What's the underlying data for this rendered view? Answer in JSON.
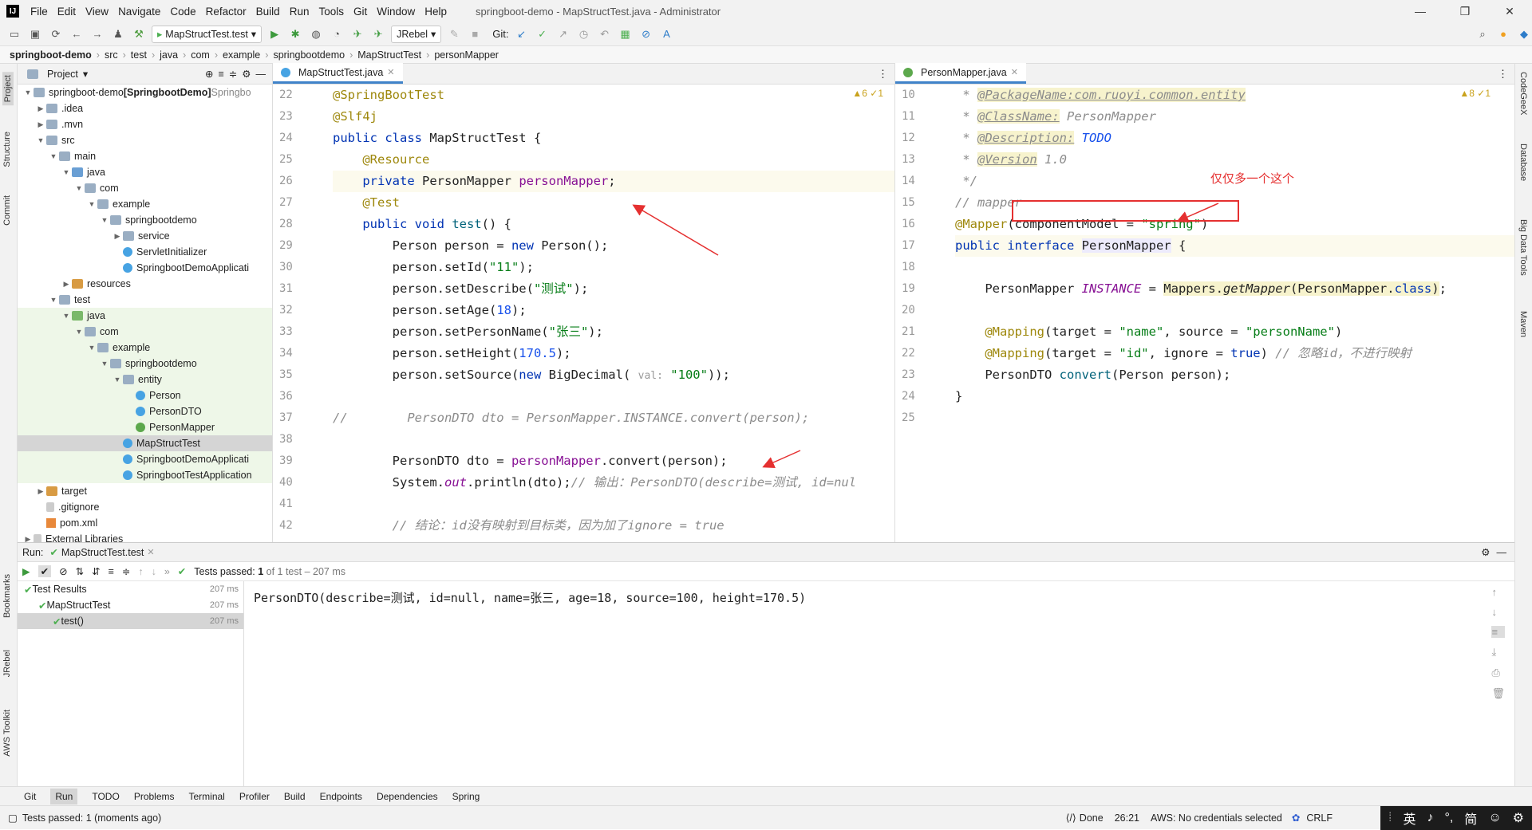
{
  "title_bar": {
    "app_icon": "IJ",
    "menu": [
      "File",
      "Edit",
      "View",
      "Navigate",
      "Code",
      "Refactor",
      "Build",
      "Run",
      "Tools",
      "Git",
      "Window",
      "Help"
    ],
    "title": "springboot-demo - MapStructTest.java - Administrator"
  },
  "toolbar": {
    "run_config": "MapStructTest.test",
    "jrebel": "JRebel",
    "git_label": "Git:"
  },
  "breadcrumb": [
    "springboot-demo",
    "src",
    "test",
    "java",
    "com",
    "example",
    "springbootdemo",
    "MapStructTest",
    "personMapper"
  ],
  "left_strip": [
    "Project",
    "Structure",
    "Commit",
    "Bookmarks",
    "JRebel",
    "AWS Toolkit"
  ],
  "right_strip": [
    "CodeGeeX",
    "Database",
    "Big Data Tools",
    "Maven"
  ],
  "project": {
    "header": "Project",
    "tree": [
      {
        "label": "springboot-demo",
        "extra": "[SpringbootDemo]",
        "hint": "Springbo",
        "depth": 0,
        "icon": "folder",
        "arrow": "v"
      },
      {
        "label": ".idea",
        "depth": 1,
        "icon": "folder",
        "arrow": ">"
      },
      {
        "label": ".mvn",
        "depth": 1,
        "icon": "folder",
        "arrow": ">"
      },
      {
        "label": "src",
        "depth": 1,
        "icon": "folder",
        "arrow": "v"
      },
      {
        "label": "main",
        "depth": 2,
        "icon": "folder",
        "arrow": "v"
      },
      {
        "label": "java",
        "depth": 3,
        "icon": "folderb",
        "arrow": "v"
      },
      {
        "label": "com",
        "depth": 4,
        "icon": "folder",
        "arrow": "v"
      },
      {
        "label": "example",
        "depth": 5,
        "icon": "folder",
        "arrow": "v"
      },
      {
        "label": "springbootdemo",
        "depth": 6,
        "icon": "folder",
        "arrow": "v"
      },
      {
        "label": "service",
        "depth": 7,
        "icon": "folder",
        "arrow": ">"
      },
      {
        "label": "ServletInitializer",
        "depth": 7,
        "icon": "cls",
        "arrow": ""
      },
      {
        "label": "SpringbootDemoApplicati",
        "depth": 7,
        "icon": "cls",
        "arrow": ""
      },
      {
        "label": "resources",
        "depth": 3,
        "icon": "foldero",
        "arrow": ">"
      },
      {
        "label": "test",
        "depth": 2,
        "icon": "folder",
        "arrow": "v"
      },
      {
        "label": "java",
        "depth": 3,
        "icon": "folderg",
        "arrow": "v",
        "green": true
      },
      {
        "label": "com",
        "depth": 4,
        "icon": "folder",
        "arrow": "v",
        "green": true
      },
      {
        "label": "example",
        "depth": 5,
        "icon": "folder",
        "arrow": "v",
        "green": true
      },
      {
        "label": "springbootdemo",
        "depth": 6,
        "icon": "folder",
        "arrow": "v",
        "green": true
      },
      {
        "label": "entity",
        "depth": 7,
        "icon": "folder",
        "arrow": "v",
        "green": true
      },
      {
        "label": "Person",
        "depth": 8,
        "icon": "cls",
        "arrow": "",
        "green": true
      },
      {
        "label": "PersonDTO",
        "depth": 8,
        "icon": "cls",
        "arrow": "",
        "green": true
      },
      {
        "label": "PersonMapper",
        "depth": 8,
        "icon": "itf",
        "arrow": "",
        "green": true
      },
      {
        "label": "MapStructTest",
        "depth": 7,
        "icon": "cls",
        "arrow": "",
        "sel": true
      },
      {
        "label": "SpringbootDemoApplicati",
        "depth": 7,
        "icon": "cls",
        "arrow": "",
        "green": true
      },
      {
        "label": "SpringbootTestApplication",
        "depth": 7,
        "icon": "cls",
        "arrow": "",
        "green": true
      },
      {
        "label": "target",
        "depth": 1,
        "icon": "foldero",
        "arrow": ">"
      },
      {
        "label": ".gitignore",
        "depth": 1,
        "icon": "none",
        "arrow": ""
      },
      {
        "label": "pom.xml",
        "depth": 1,
        "icon": "xml",
        "arrow": ""
      },
      {
        "label": "External Libraries",
        "depth": 0,
        "icon": "none",
        "arrow": ">"
      }
    ]
  },
  "editor_left": {
    "tab": "MapStructTest.java",
    "inspections": "▲6 ✓1",
    "line_numbers": [
      "22",
      "23",
      "24",
      "25",
      "26",
      "27",
      "28",
      "29",
      "30",
      "31",
      "32",
      "33",
      "34",
      "35",
      "36",
      "37",
      "38",
      "39",
      "40",
      "41",
      "42"
    ]
  },
  "editor_right": {
    "tab": "PersonMapper.java",
    "inspections": "▲8 ✓1",
    "line_numbers": [
      "10",
      "11",
      "12",
      "13",
      "14",
      "15",
      "16",
      "17",
      "18",
      "19",
      "20",
      "21",
      "22",
      "23",
      "24",
      "25"
    ],
    "annotation": "仅仅多一个这个"
  },
  "run": {
    "label": "Run:",
    "tab": "MapStructTest.test",
    "status": "Tests passed:",
    "status_count": "1",
    "status_rest": "of 1 test – 207 ms",
    "tree": [
      {
        "label": "Test Results",
        "time": "207 ms",
        "depth": 0
      },
      {
        "label": "MapStructTest",
        "time": "207 ms",
        "depth": 1
      },
      {
        "label": "test()",
        "time": "207 ms",
        "depth": 2
      }
    ],
    "output": "PersonDTO(describe=测试, id=null, name=张三, age=18, source=100, height=170.5)"
  },
  "bottom_tabs": [
    "Git",
    "Run",
    "TODO",
    "Problems",
    "Terminal",
    "Profiler",
    "Build",
    "Endpoints",
    "Dependencies",
    "Spring"
  ],
  "status_bar": {
    "left": "Tests passed: 1 (moments ago)",
    "done": "Done",
    "position": "26:21",
    "aws": "AWS: No credentials selected",
    "eol": "CRLF"
  },
  "ime": [
    "英",
    "♪",
    "简",
    "☺",
    "⚙"
  ]
}
